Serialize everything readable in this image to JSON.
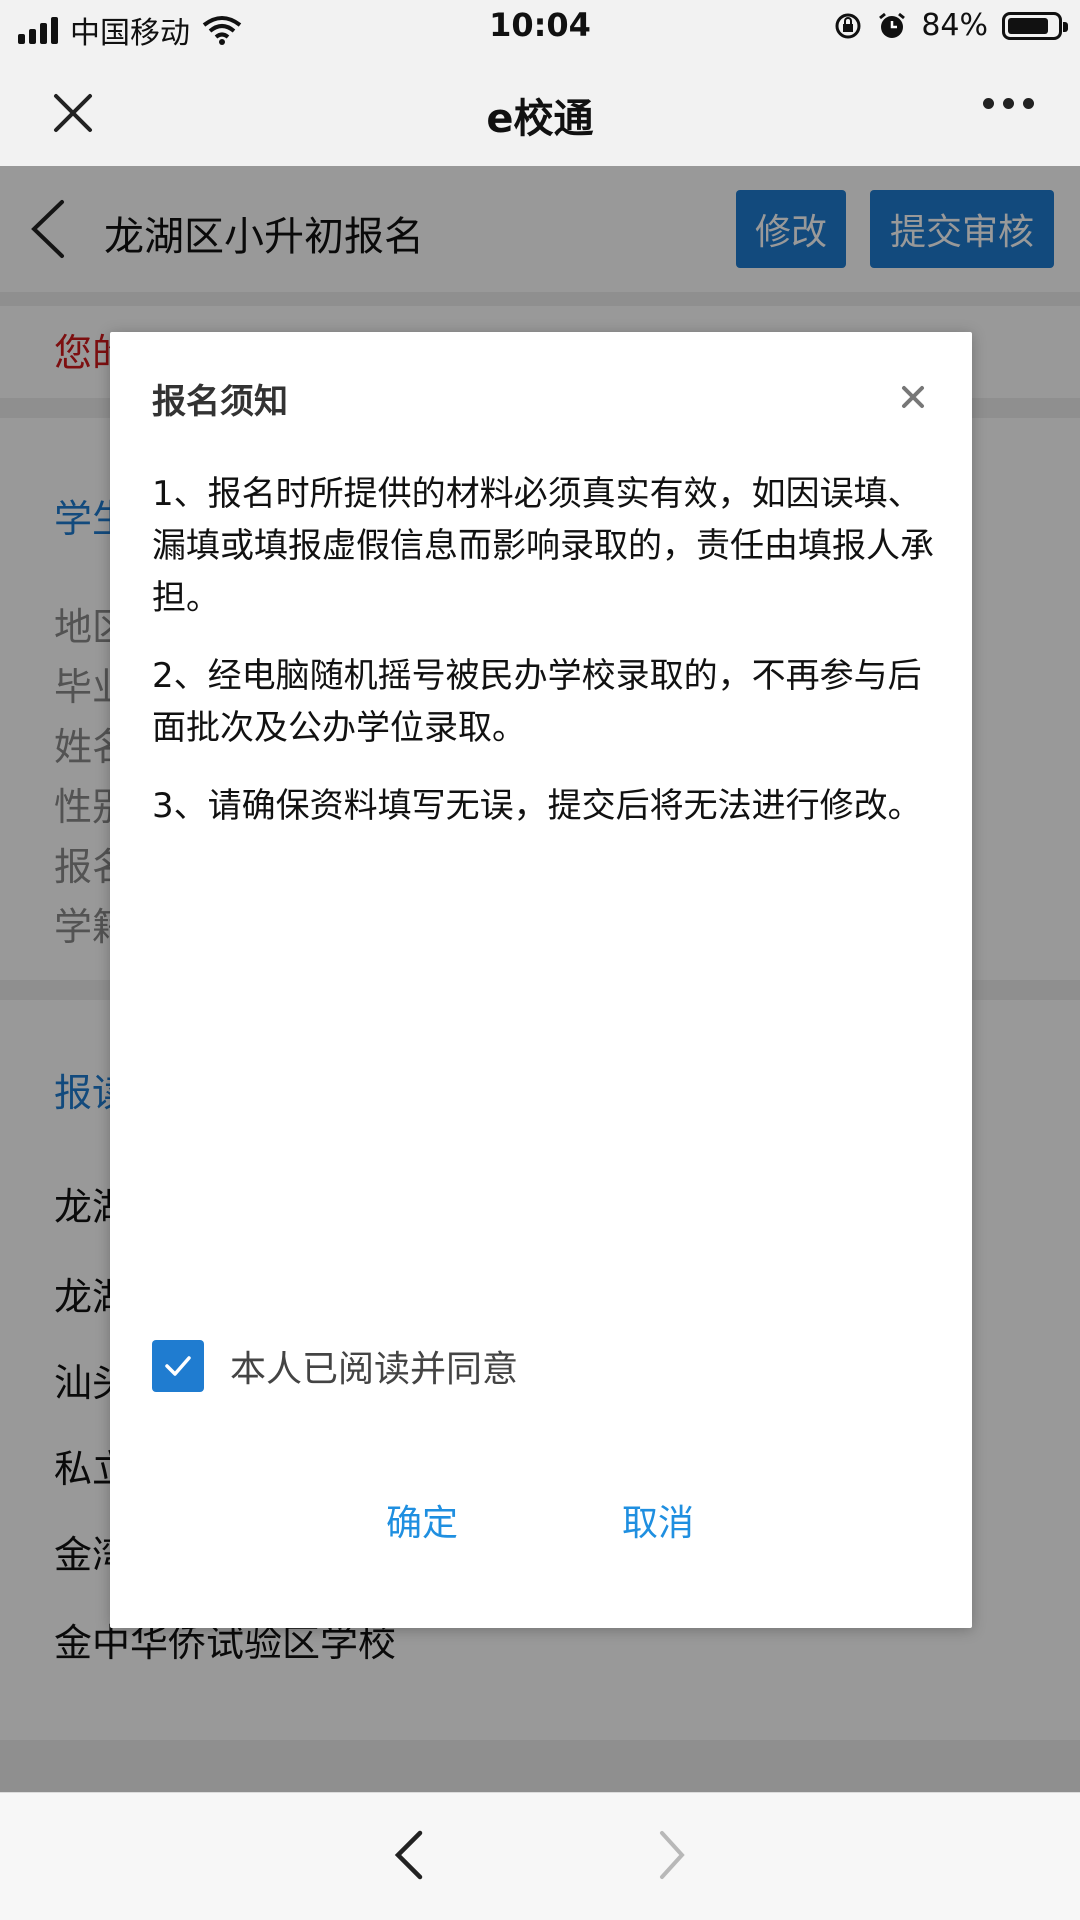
{
  "status_bar": {
    "carrier": "中国移动",
    "time": "10:04",
    "battery_percent": "84%",
    "battery_level": 0.84
  },
  "nav": {
    "title": "e校通"
  },
  "page": {
    "title": "龙湖区小升初报名",
    "edit_label": "修改",
    "submit_label": "提交审核",
    "warning_prefix": "您的",
    "section_student_prefix": "学生",
    "info_prefixes": [
      "地区",
      "毕业",
      "姓名",
      "性别",
      "报名",
      "学籍"
    ],
    "section_apply_prefix": "报读",
    "school_prefixes": [
      "龙湖",
      "龙湖",
      "汕头",
      "私立",
      "金湾"
    ],
    "last_school": "金中华侨试验区学校"
  },
  "modal": {
    "title": "报名须知",
    "items": [
      "1、报名时所提供的材料必须真实有效，如因误填、漏填或填报虚假信息而影响录取的，责任由填报人承担。",
      "2、经电脑随机摇号被民办学校录取的，不再参与后面批次及公办学位录取。",
      "3、请确保资料填写无误，提交后将无法进行修改。"
    ],
    "agree_label": "本人已阅读并同意",
    "agree_checked": true,
    "confirm_label": "确定",
    "cancel_label": "取消"
  },
  "colors": {
    "accent_blue": "#1f7cd0",
    "link_blue": "#1f8fe0",
    "warning_red": "#d0191c"
  }
}
